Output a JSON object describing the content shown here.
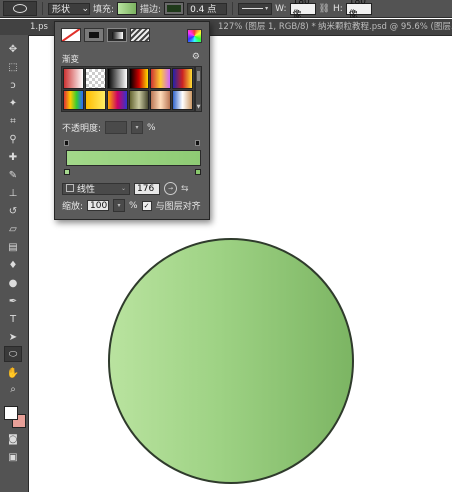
{
  "option_bar": {
    "mode": "形状",
    "fill_label": "填充:",
    "stroke_label": "描边:",
    "stroke_width": "0.4 点",
    "w_label": "W:",
    "w_value": "180 像",
    "h_label": "H:",
    "h_value": "180 像"
  },
  "tabs": {
    "first": "1.ps",
    "mid": "127% (图层 1, RGB/8) *",
    "last": "纳米颗粒教程.psd @ 95.6% (图层..."
  },
  "panel": {
    "gradient_title": "渐变",
    "opacity_label": "不透明度:",
    "opacity_unit": "%",
    "style_value": "线性",
    "angle_value": "176",
    "scale_label": "缩放:",
    "scale_value": "100",
    "scale_unit": "%",
    "align_label": "与图层对齐",
    "align_checked": true,
    "gradient_colors": [
      "#a3d98a",
      "#8ecb74"
    ]
  },
  "canvas": {
    "circle_colors": [
      "#b9e39f",
      "#7cb563"
    ],
    "stroke_color": "#2f3b2c"
  },
  "icons": [
    "ellipse-tool-icon",
    "move-icon",
    "marquee-icon",
    "lasso-icon",
    "magic-wand-icon",
    "crop-icon",
    "eyedropper-icon",
    "healing-icon",
    "brush-icon",
    "clone-stamp-icon",
    "history-brush-icon",
    "eraser-icon",
    "gradient-icon",
    "blur-icon",
    "dodge-icon",
    "pen-icon",
    "type-icon",
    "path-select-icon",
    "ellipse-icon",
    "hand-icon",
    "zoom-icon",
    "quick-mask-icon",
    "screen-mode-icon"
  ]
}
